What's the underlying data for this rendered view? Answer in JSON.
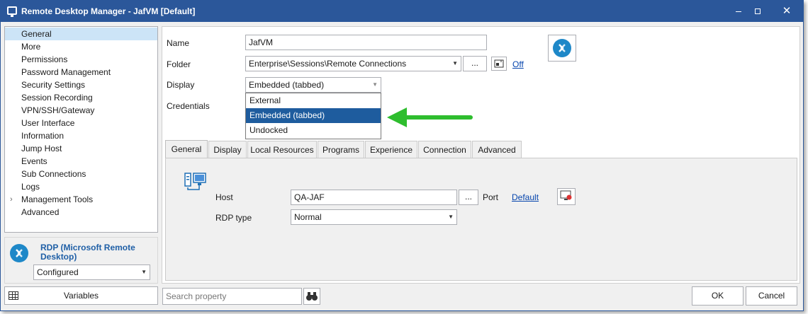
{
  "window": {
    "title": "Remote Desktop Manager - JafVM [Default]",
    "min_glyph": "",
    "max_glyph": "",
    "close_glyph": "✕"
  },
  "sidebar": {
    "items": [
      {
        "label": "General",
        "selected": true
      },
      {
        "label": "More"
      },
      {
        "label": "Permissions"
      },
      {
        "label": "Password Management"
      },
      {
        "label": "Security Settings"
      },
      {
        "label": "Session Recording"
      },
      {
        "label": "VPN/SSH/Gateway"
      },
      {
        "label": "User Interface"
      },
      {
        "label": "Information"
      },
      {
        "label": "Jump Host"
      },
      {
        "label": "Events"
      },
      {
        "label": "Sub Connections"
      },
      {
        "label": "Logs"
      },
      {
        "label": "Management Tools",
        "expandable": true
      },
      {
        "label": "Advanced"
      }
    ],
    "expand_glyph": "›"
  },
  "entry_type": {
    "label": "RDP (Microsoft Remote Desktop)",
    "status_value": "Configured",
    "accent": "#1f5fa6"
  },
  "variables_button": "Variables",
  "form": {
    "name_label": "Name",
    "name_value": "JafVM",
    "folder_label": "Folder",
    "folder_value": "Enterprise\\Sessions\\Remote Connections",
    "folder_browse": "...",
    "folder_off_link": "Off",
    "display_label": "Display",
    "display_value": "Embedded (tabbed)",
    "credentials_label": "Credentials",
    "display_options": [
      "External",
      "Embedded (tabbed)",
      "Undocked"
    ],
    "display_selected_index": 1
  },
  "tabs": [
    "General",
    "Display",
    "Local Resources",
    "Programs",
    "Experience",
    "Connection",
    "Advanced"
  ],
  "general_tab": {
    "host_label": "Host",
    "host_value": "QA-JAF",
    "host_browse": "...",
    "port_label": "Port",
    "port_link": "Default",
    "rdp_type_label": "RDP type",
    "rdp_type_value": "Normal"
  },
  "footer": {
    "search_placeholder": "Search property",
    "ok": "OK",
    "cancel": "Cancel"
  },
  "colors": {
    "titlebar": "#2b579a",
    "selection": "#1e5c9e",
    "sidebar_selected": "#cce4f7",
    "pointer_arrow": "#2ebd2e",
    "link": "#0645ad"
  }
}
